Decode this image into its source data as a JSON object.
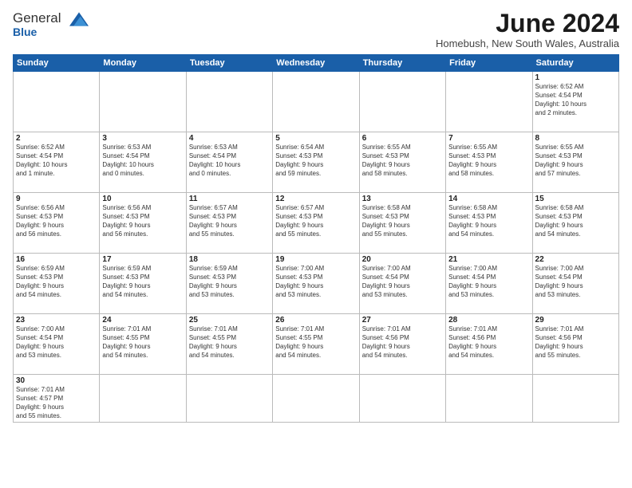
{
  "header": {
    "logo_general": "General",
    "logo_blue": "Blue",
    "month_title": "June 2024",
    "subtitle": "Homebush, New South Wales, Australia"
  },
  "weekdays": [
    "Sunday",
    "Monday",
    "Tuesday",
    "Wednesday",
    "Thursday",
    "Friday",
    "Saturday"
  ],
  "weeks": [
    [
      {
        "day": "",
        "info": ""
      },
      {
        "day": "",
        "info": ""
      },
      {
        "day": "",
        "info": ""
      },
      {
        "day": "",
        "info": ""
      },
      {
        "day": "",
        "info": ""
      },
      {
        "day": "",
        "info": ""
      },
      {
        "day": "1",
        "info": "Sunrise: 6:52 AM\nSunset: 4:54 PM\nDaylight: 10 hours\nand 2 minutes."
      }
    ],
    [
      {
        "day": "2",
        "info": "Sunrise: 6:52 AM\nSunset: 4:54 PM\nDaylight: 10 hours\nand 1 minute."
      },
      {
        "day": "3",
        "info": "Sunrise: 6:53 AM\nSunset: 4:54 PM\nDaylight: 10 hours\nand 0 minutes."
      },
      {
        "day": "4",
        "info": "Sunrise: 6:53 AM\nSunset: 4:54 PM\nDaylight: 10 hours\nand 0 minutes."
      },
      {
        "day": "5",
        "info": "Sunrise: 6:54 AM\nSunset: 4:53 PM\nDaylight: 9 hours\nand 59 minutes."
      },
      {
        "day": "6",
        "info": "Sunrise: 6:55 AM\nSunset: 4:53 PM\nDaylight: 9 hours\nand 58 minutes."
      },
      {
        "day": "7",
        "info": "Sunrise: 6:55 AM\nSunset: 4:53 PM\nDaylight: 9 hours\nand 58 minutes."
      },
      {
        "day": "8",
        "info": "Sunrise: 6:55 AM\nSunset: 4:53 PM\nDaylight: 9 hours\nand 57 minutes."
      }
    ],
    [
      {
        "day": "9",
        "info": "Sunrise: 6:56 AM\nSunset: 4:53 PM\nDaylight: 9 hours\nand 56 minutes."
      },
      {
        "day": "10",
        "info": "Sunrise: 6:56 AM\nSunset: 4:53 PM\nDaylight: 9 hours\nand 56 minutes."
      },
      {
        "day": "11",
        "info": "Sunrise: 6:57 AM\nSunset: 4:53 PM\nDaylight: 9 hours\nand 55 minutes."
      },
      {
        "day": "12",
        "info": "Sunrise: 6:57 AM\nSunset: 4:53 PM\nDaylight: 9 hours\nand 55 minutes."
      },
      {
        "day": "13",
        "info": "Sunrise: 6:58 AM\nSunset: 4:53 PM\nDaylight: 9 hours\nand 55 minutes."
      },
      {
        "day": "14",
        "info": "Sunrise: 6:58 AM\nSunset: 4:53 PM\nDaylight: 9 hours\nand 54 minutes."
      },
      {
        "day": "15",
        "info": "Sunrise: 6:58 AM\nSunset: 4:53 PM\nDaylight: 9 hours\nand 54 minutes."
      }
    ],
    [
      {
        "day": "16",
        "info": "Sunrise: 6:59 AM\nSunset: 4:53 PM\nDaylight: 9 hours\nand 54 minutes."
      },
      {
        "day": "17",
        "info": "Sunrise: 6:59 AM\nSunset: 4:53 PM\nDaylight: 9 hours\nand 54 minutes."
      },
      {
        "day": "18",
        "info": "Sunrise: 6:59 AM\nSunset: 4:53 PM\nDaylight: 9 hours\nand 53 minutes."
      },
      {
        "day": "19",
        "info": "Sunrise: 7:00 AM\nSunset: 4:53 PM\nDaylight: 9 hours\nand 53 minutes."
      },
      {
        "day": "20",
        "info": "Sunrise: 7:00 AM\nSunset: 4:54 PM\nDaylight: 9 hours\nand 53 minutes."
      },
      {
        "day": "21",
        "info": "Sunrise: 7:00 AM\nSunset: 4:54 PM\nDaylight: 9 hours\nand 53 minutes."
      },
      {
        "day": "22",
        "info": "Sunrise: 7:00 AM\nSunset: 4:54 PM\nDaylight: 9 hours\nand 53 minutes."
      }
    ],
    [
      {
        "day": "23",
        "info": "Sunrise: 7:00 AM\nSunset: 4:54 PM\nDaylight: 9 hours\nand 53 minutes."
      },
      {
        "day": "24",
        "info": "Sunrise: 7:01 AM\nSunset: 4:55 PM\nDaylight: 9 hours\nand 54 minutes."
      },
      {
        "day": "25",
        "info": "Sunrise: 7:01 AM\nSunset: 4:55 PM\nDaylight: 9 hours\nand 54 minutes."
      },
      {
        "day": "26",
        "info": "Sunrise: 7:01 AM\nSunset: 4:55 PM\nDaylight: 9 hours\nand 54 minutes."
      },
      {
        "day": "27",
        "info": "Sunrise: 7:01 AM\nSunset: 4:56 PM\nDaylight: 9 hours\nand 54 minutes."
      },
      {
        "day": "28",
        "info": "Sunrise: 7:01 AM\nSunset: 4:56 PM\nDaylight: 9 hours\nand 54 minutes."
      },
      {
        "day": "29",
        "info": "Sunrise: 7:01 AM\nSunset: 4:56 PM\nDaylight: 9 hours\nand 55 minutes."
      }
    ],
    [
      {
        "day": "30",
        "info": "Sunrise: 7:01 AM\nSunset: 4:57 PM\nDaylight: 9 hours\nand 55 minutes."
      },
      {
        "day": "",
        "info": ""
      },
      {
        "day": "",
        "info": ""
      },
      {
        "day": "",
        "info": ""
      },
      {
        "day": "",
        "info": ""
      },
      {
        "day": "",
        "info": ""
      },
      {
        "day": "",
        "info": ""
      }
    ]
  ]
}
